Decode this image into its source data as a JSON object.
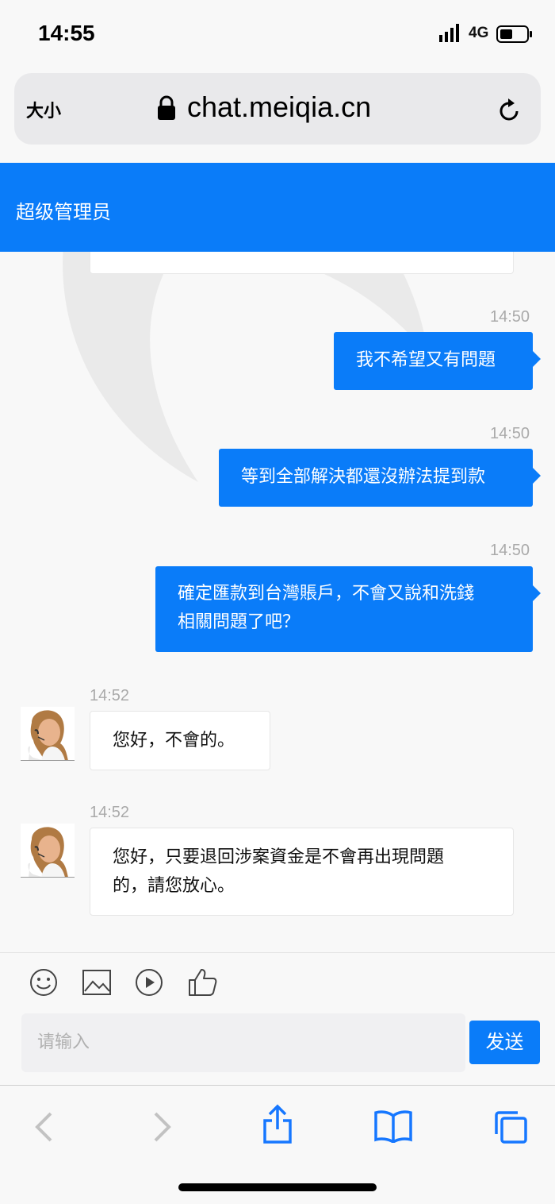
{
  "status_bar": {
    "time": "14:55",
    "network": "4G"
  },
  "address_bar": {
    "text_size_label": "大小",
    "url": "chat.meiqia.cn"
  },
  "chat_header": {
    "title": "超级管理员"
  },
  "messages": [
    {
      "time": "14:50",
      "lines": [
        "我不希望又有問題"
      ]
    },
    {
      "time": "14:50",
      "lines": [
        "等到全部解決都還沒辦法提到款"
      ]
    },
    {
      "time": "14:50",
      "lines": [
        "確定匯款到台灣賬戶，不會又說和洗錢",
        "相關問題了吧？"
      ]
    },
    {
      "time": "14:52",
      "lines": [
        "您好，不會的。"
      ]
    },
    {
      "time": "14:52",
      "lines": [
        "您好，只要退回涉案資金是不會再出現問題",
        "的，請您放心。"
      ]
    }
  ],
  "composer": {
    "placeholder": "请输入",
    "send_label": "发送"
  },
  "colors": {
    "accent": "#0a7cf9",
    "background": "#f8f8f8",
    "browser_icon": "#1677ff"
  }
}
